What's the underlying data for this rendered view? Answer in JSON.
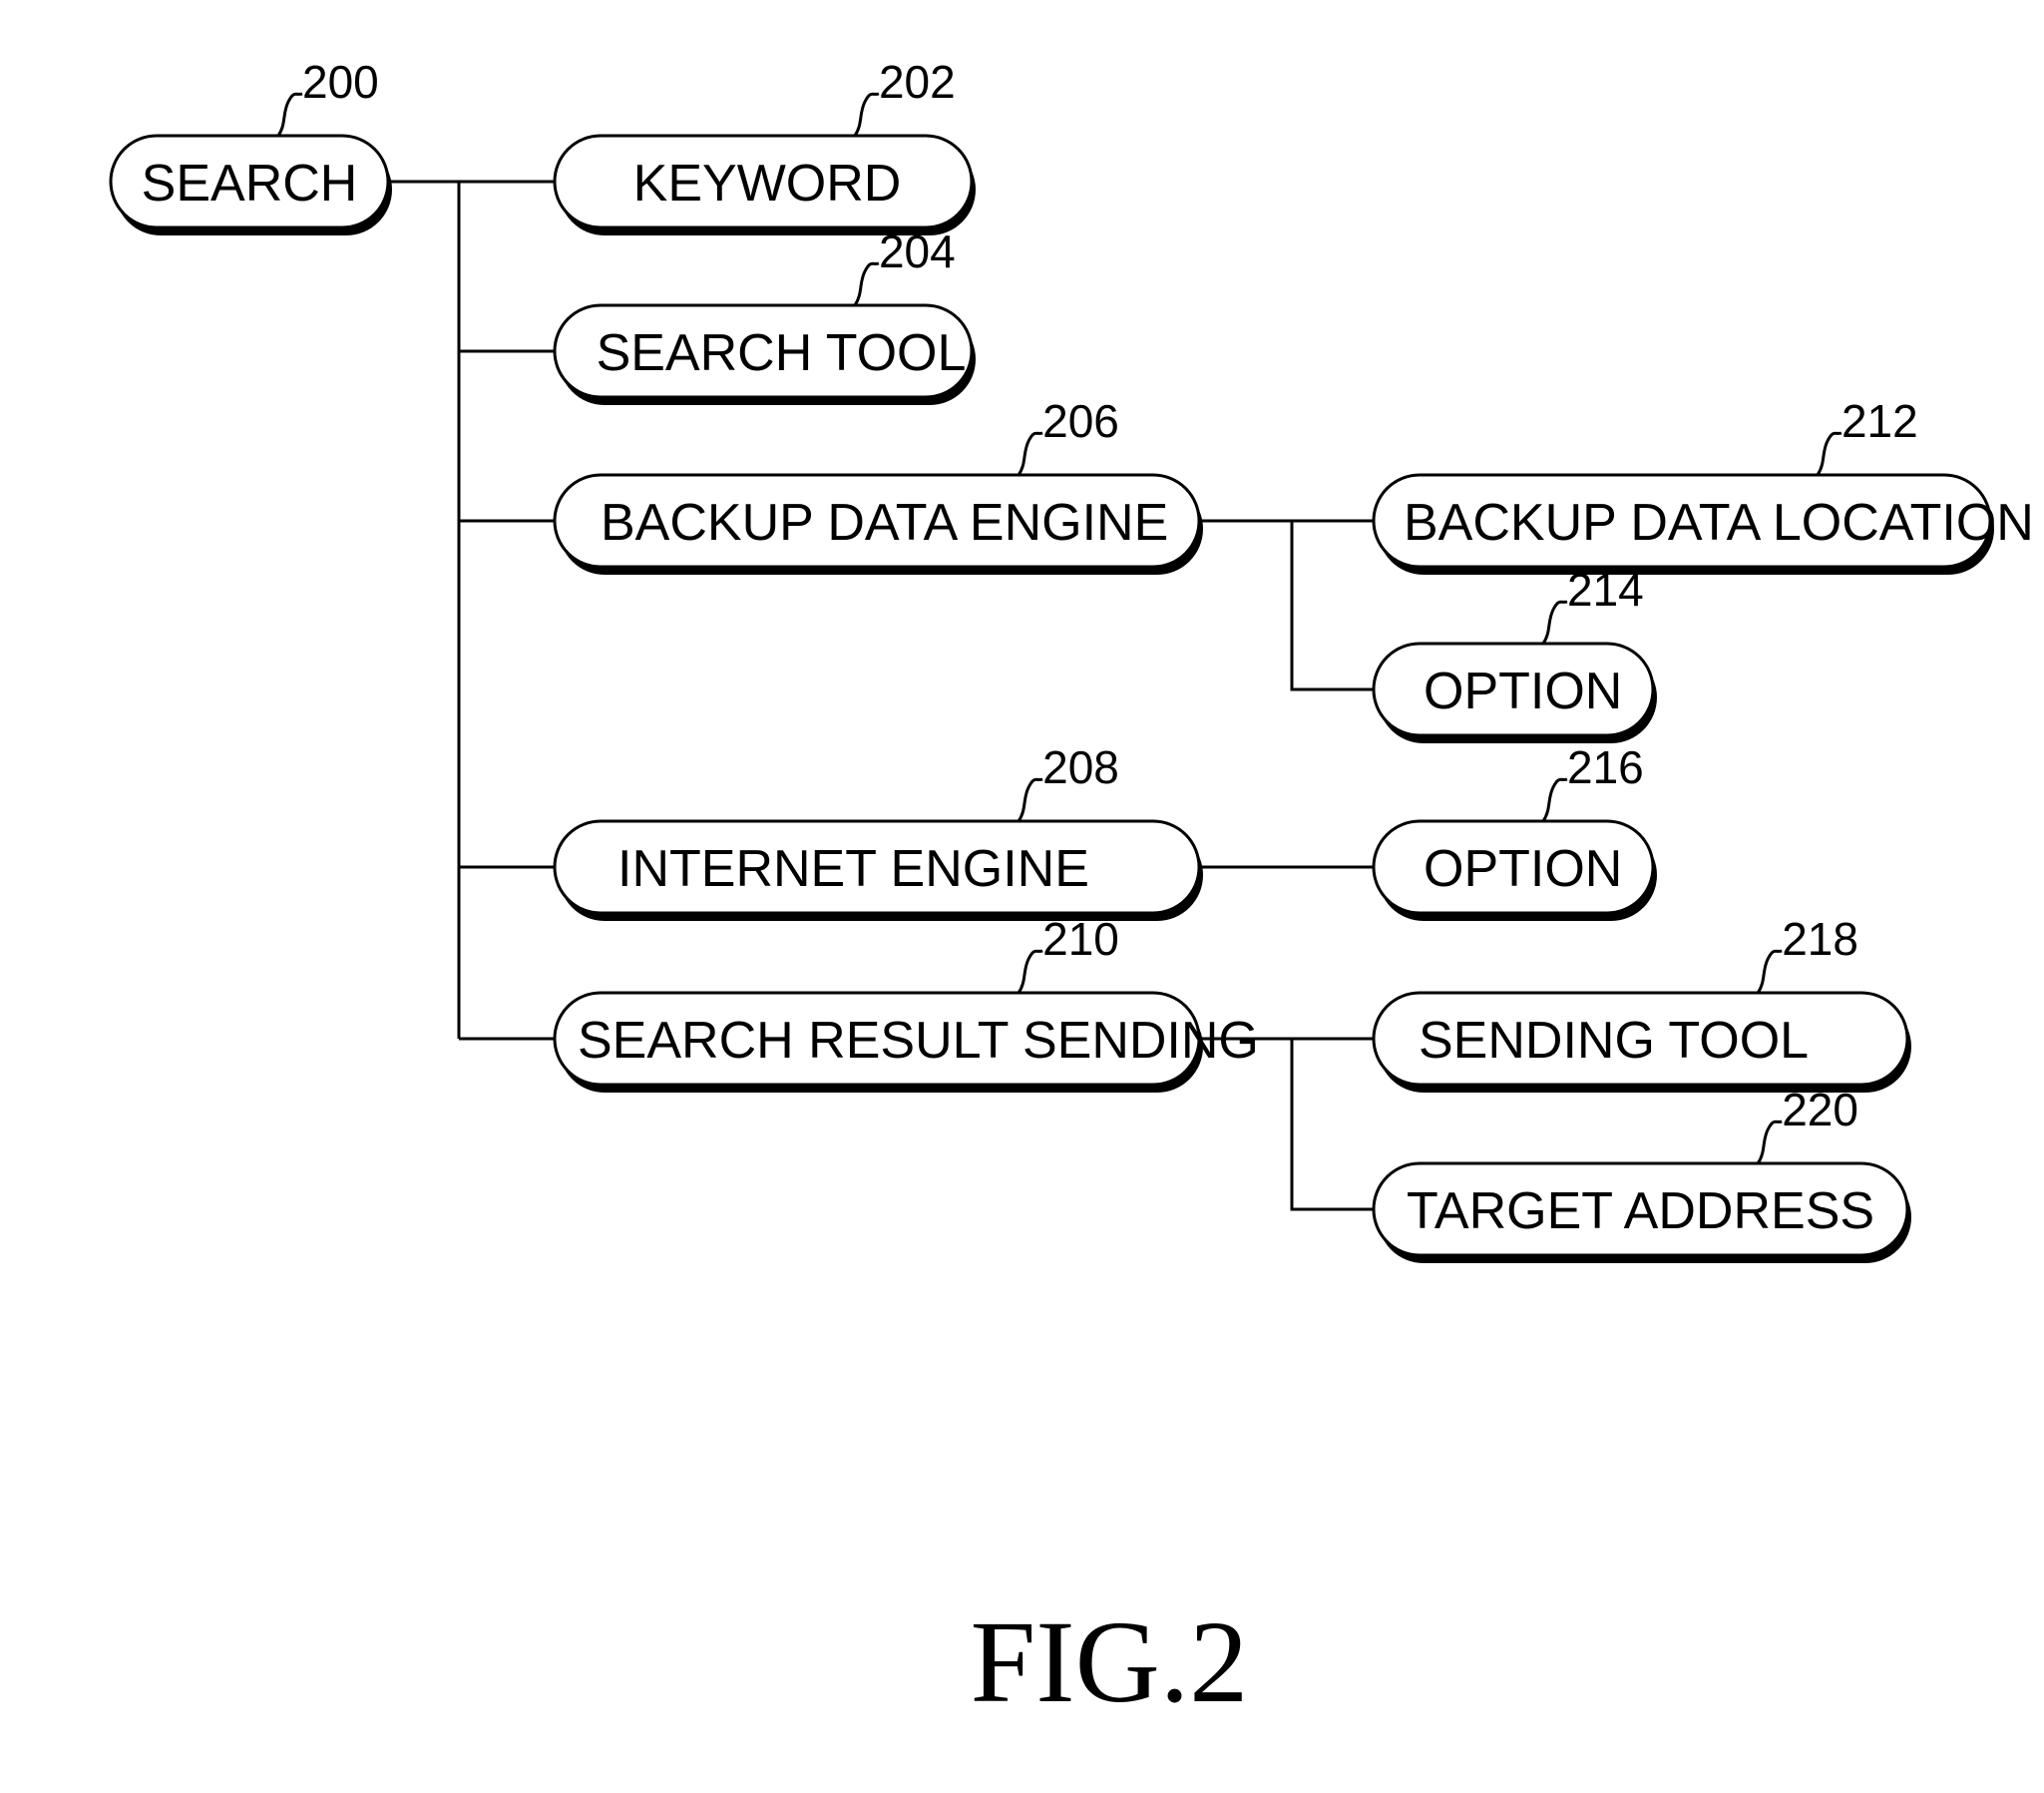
{
  "figure_label": "FIG.2",
  "nodes": [
    {
      "id": "search",
      "label": "SEARCH",
      "ref": "200"
    },
    {
      "id": "keyword",
      "label": "KEYWORD",
      "ref": "202"
    },
    {
      "id": "search-tool",
      "label": "SEARCH TOOL",
      "ref": "204"
    },
    {
      "id": "backup-data-engine",
      "label": "BACKUP DATA ENGINE",
      "ref": "206"
    },
    {
      "id": "internet-engine",
      "label": "INTERNET ENGINE",
      "ref": "208"
    },
    {
      "id": "search-result-sending",
      "label": "SEARCH RESULT SENDING",
      "ref": "210"
    },
    {
      "id": "backup-data-location",
      "label": "BACKUP DATA LOCATION",
      "ref": "212"
    },
    {
      "id": "option-214",
      "label": "OPTION",
      "ref": "214"
    },
    {
      "id": "option-216",
      "label": "OPTION",
      "ref": "216"
    },
    {
      "id": "sending-tool",
      "label": "SENDING TOOL",
      "ref": "218"
    },
    {
      "id": "target-address",
      "label": "TARGET ADDRESS",
      "ref": "220"
    }
  ],
  "edges": [
    [
      "search",
      "keyword"
    ],
    [
      "search",
      "search-tool"
    ],
    [
      "search",
      "backup-data-engine"
    ],
    [
      "search",
      "internet-engine"
    ],
    [
      "search",
      "search-result-sending"
    ],
    [
      "backup-data-engine",
      "backup-data-location"
    ],
    [
      "backup-data-engine",
      "option-214"
    ],
    [
      "internet-engine",
      "option-216"
    ],
    [
      "search-result-sending",
      "sending-tool"
    ],
    [
      "search-result-sending",
      "target-address"
    ]
  ]
}
